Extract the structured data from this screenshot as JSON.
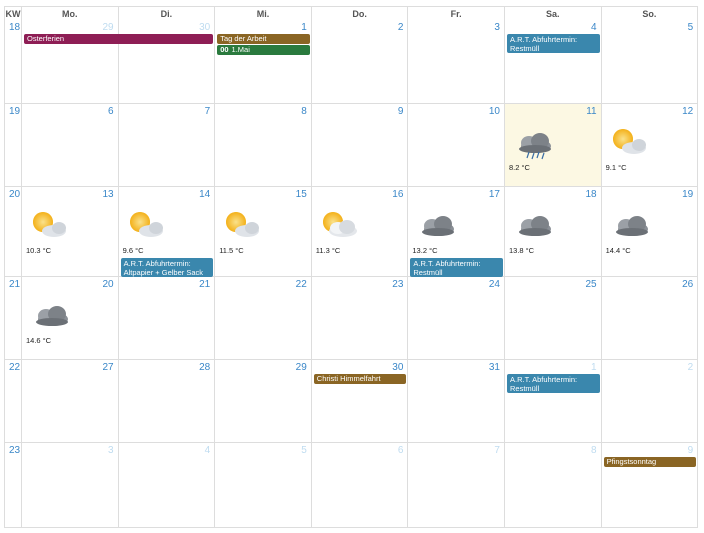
{
  "headers": [
    "KW",
    "Mo.",
    "Di.",
    "Mi.",
    "Do.",
    "Fr.",
    "Sa.",
    "So."
  ],
  "weeks": [
    {
      "kw": "18",
      "days": [
        "29",
        "30",
        "1",
        "2",
        "3",
        "4",
        "5"
      ],
      "other": [
        true,
        true,
        false,
        false,
        false,
        false,
        false
      ]
    },
    {
      "kw": "19",
      "days": [
        "6",
        "7",
        "8",
        "9",
        "10",
        "11",
        "12"
      ],
      "other": [
        false,
        false,
        false,
        false,
        false,
        false,
        false
      ]
    },
    {
      "kw": "20",
      "days": [
        "13",
        "14",
        "15",
        "16",
        "17",
        "18",
        "19"
      ],
      "other": [
        false,
        false,
        false,
        false,
        false,
        false,
        false
      ]
    },
    {
      "kw": "21",
      "days": [
        "20",
        "21",
        "22",
        "23",
        "24",
        "25",
        "26"
      ],
      "other": [
        false,
        false,
        false,
        false,
        false,
        false,
        false
      ]
    },
    {
      "kw": "22",
      "days": [
        "27",
        "28",
        "29",
        "30",
        "31",
        "1",
        "2"
      ],
      "other": [
        false,
        false,
        false,
        false,
        false,
        true,
        true
      ]
    },
    {
      "kw": "23",
      "days": [
        "3",
        "4",
        "5",
        "6",
        "7",
        "8",
        "9"
      ],
      "other": [
        true,
        true,
        true,
        true,
        true,
        true,
        true
      ]
    }
  ],
  "events": [
    {
      "week": 0,
      "col": 0,
      "span": 2,
      "row": 0,
      "title": "Osterferien",
      "color": "purple"
    },
    {
      "week": 0,
      "col": 2,
      "span": 1,
      "row": 0,
      "title": "Tag der Arbeit",
      "color": "brown"
    },
    {
      "week": 0,
      "col": 2,
      "span": 1,
      "row": 1,
      "time": "00",
      "title": "1.Mai",
      "color": "green"
    },
    {
      "week": 0,
      "col": 5,
      "span": 1,
      "row": 0,
      "title": "A.R.T. Abfuhrtermin: Restmüll",
      "color": "blue",
      "two": true
    },
    {
      "week": 2,
      "col": 1,
      "span": 1,
      "row": 0,
      "title": "A.R.T. Abfuhrtermin: Altpapier + Gelber Sack",
      "color": "blue",
      "two": true,
      "wx": true
    },
    {
      "week": 2,
      "col": 4,
      "span": 1,
      "row": 0,
      "title": "A.R.T. Abfuhrtermin: Restmüll",
      "color": "blue",
      "two": true,
      "wx": true
    },
    {
      "week": 4,
      "col": 3,
      "span": 1,
      "row": 0,
      "title": "Christi Himmelfahrt",
      "color": "brown"
    },
    {
      "week": 4,
      "col": 5,
      "span": 1,
      "row": 0,
      "title": "A.R.T. Abfuhrtermin: Restmüll",
      "color": "blue",
      "two": true
    },
    {
      "week": 5,
      "col": 6,
      "span": 1,
      "row": 0,
      "title": "Pfingstsonntag",
      "color": "brown"
    }
  ],
  "weather": [
    {
      "week": 1,
      "col": 5,
      "icon": "rain-cloud-icon",
      "temp": "8.2 °C"
    },
    {
      "week": 1,
      "col": 6,
      "icon": "sun-cloud-icon",
      "temp": "9.1 °C"
    },
    {
      "week": 2,
      "col": 0,
      "icon": "sun-cloud-icon",
      "temp": "10.3 °C"
    },
    {
      "week": 2,
      "col": 1,
      "icon": "sun-cloud-icon",
      "temp": "9.6 °C"
    },
    {
      "week": 2,
      "col": 2,
      "icon": "sun-cloud-icon",
      "temp": "11.5 °C"
    },
    {
      "week": 2,
      "col": 3,
      "icon": "sun-cloud-light-icon",
      "temp": "11.3 °C"
    },
    {
      "week": 2,
      "col": 4,
      "icon": "cloud-icon",
      "temp": "13.2 °C"
    },
    {
      "week": 2,
      "col": 5,
      "icon": "cloud-icon",
      "temp": "13.8 °C"
    },
    {
      "week": 2,
      "col": 6,
      "icon": "cloud-icon",
      "temp": "14.4 °C"
    },
    {
      "week": 3,
      "col": 0,
      "icon": "cloud-icon",
      "temp": "14.6 °C"
    }
  ],
  "today": {
    "week": 1,
    "col": 5
  }
}
